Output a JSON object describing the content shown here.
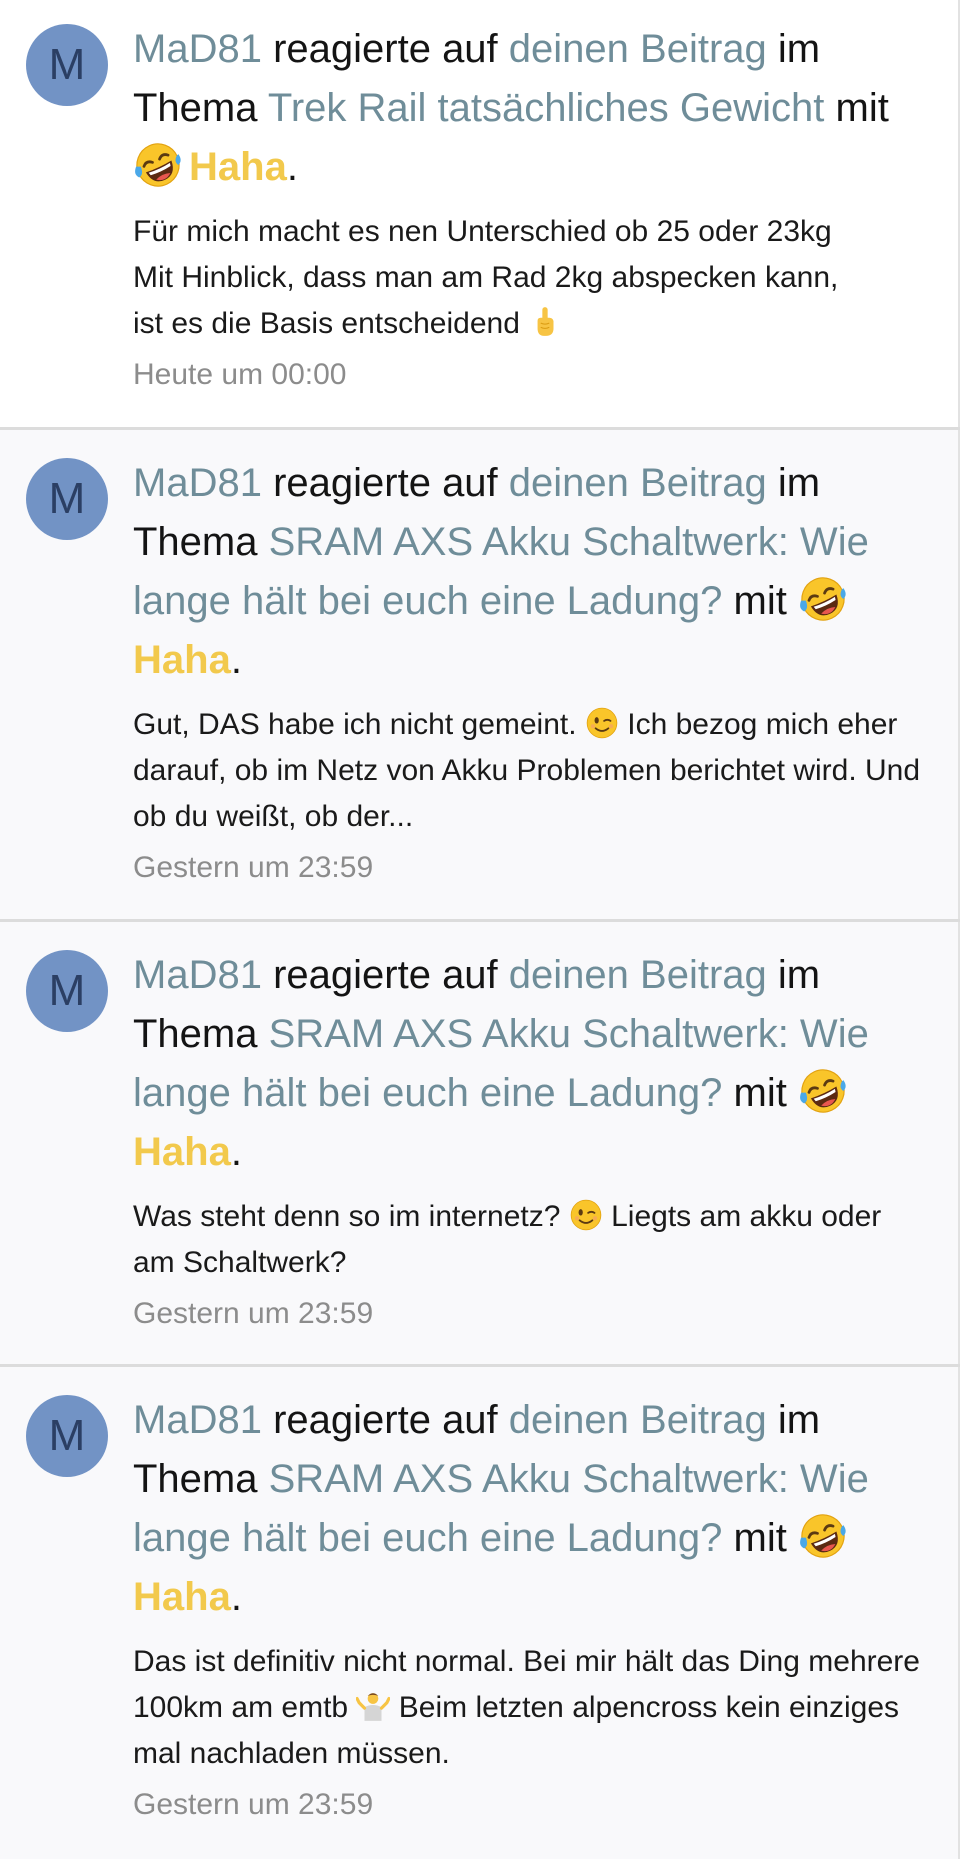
{
  "alerts": [
    {
      "avatar_letter": "M",
      "user": "MaD81",
      "action": "reagierte auf",
      "post_link": "deinen Beitrag",
      "in_thread": "im Thema",
      "thread": "Trek Rail tatsächliches Gewicht",
      "with": "mit",
      "reaction": "Haha",
      "snippet_lines": [
        "Für mich macht es nen Unterschied ob 25 oder 23kg",
        "Mit Hinblick, dass man am Rad 2kg abspecken kann,",
        "ist es die Basis entscheidend"
      ],
      "snippet_emoji": "pointing-up-icon",
      "time": "Heute um 00:00"
    },
    {
      "avatar_letter": "M",
      "user": "MaD81",
      "action": "reagierte auf",
      "post_link": "deinen Beitrag",
      "in_thread": "im Thema",
      "thread": "SRAM AXS Akku Schaltwerk: Wie lange hält bei euch eine Ladung?",
      "with": "mit",
      "reaction": "Haha",
      "snippet_lines": [
        "Gut, DAS habe ich nicht gemeint.",
        "Ich bezog mich eher darauf, ob im Netz von Akku Problemen berichtet wird. Und ob du weißt, ob der..."
      ],
      "snippet_emoji": "wink-icon",
      "time": "Gestern um 23:59"
    },
    {
      "avatar_letter": "M",
      "user": "MaD81",
      "action": "reagierte auf",
      "post_link": "deinen Beitrag",
      "in_thread": "im Thema",
      "thread": "SRAM AXS Akku Schaltwerk: Wie lange hält bei euch eine Ladung?",
      "with": "mit",
      "reaction": "Haha",
      "snippet_lines": [
        "Was steht denn so im internetz?",
        "Liegts am akku oder am Schaltwerk?"
      ],
      "snippet_emoji": "wink-icon",
      "time": "Gestern um 23:59"
    },
    {
      "avatar_letter": "M",
      "user": "MaD81",
      "action": "reagierte auf",
      "post_link": "deinen Beitrag",
      "in_thread": "im Thema",
      "thread": "SRAM AXS Akku Schaltwerk: Wie lange hält bei euch eine Ladung?",
      "with": "mit",
      "reaction": "Haha",
      "snippet_lines": [
        "Das ist definitiv nicht normal. Bei mir hält das Ding mehrere 100km am emtb",
        "Beim letzten alpencross kein einziges mal nachladen müssen."
      ],
      "snippet_emoji": "shrug-icon",
      "time": "Gestern um 23:59"
    }
  ],
  "colors": {
    "link": "#6f8d99",
    "reaction": "#f2c94c",
    "avatar_bg": "#7293c5",
    "avatar_letter": "#2b3f64",
    "timestamp": "#8c8c8c",
    "divider": "#dcdcdc"
  }
}
